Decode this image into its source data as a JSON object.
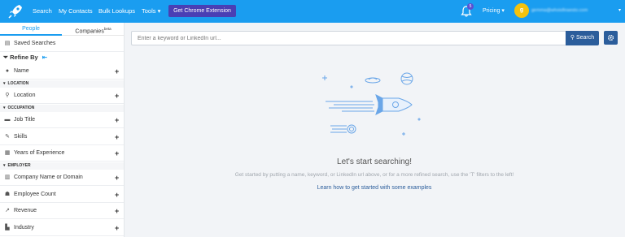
{
  "topbar": {
    "nav": {
      "search": "Search",
      "contacts": "My Contacts",
      "bulk": "Bulk Lookups",
      "tools": "Tools"
    },
    "tools_caret": "▾",
    "chrome_button": "Get Chrome Extension",
    "notification_count": "5",
    "pricing": "Pricing",
    "pricing_caret": "▾",
    "avatar_letter": "g",
    "user_email": "gemma@whoisfinaesto.com",
    "user_caret": "▾",
    "colors": {
      "bar": "#1a9df0",
      "chrome_button": "#4a3fb4",
      "avatar": "#f4c20d"
    }
  },
  "sidebar": {
    "tabs": {
      "people": "People",
      "companies": "Companies",
      "companies_badge": "beta"
    },
    "saved_searches": "Saved Searches",
    "refine_by": "Refine By",
    "refine_collapse_icon": "collapse-left-arrow",
    "filters": {
      "name": "Name",
      "location_section": "LOCATION",
      "location": "Location",
      "occupation_section": "OCCUPATION",
      "job_title": "Job Title",
      "skills": "Skills",
      "years_experience": "Years of Experience",
      "employer_section": "EMPLOYER",
      "company": "Company Name or Domain",
      "employee_count": "Employee Count",
      "revenue": "Revenue",
      "industry": "Industry"
    },
    "plus": "+",
    "section_caret": "▾"
  },
  "main": {
    "search_placeholder": "Enter a keyword or LinkedIn url...",
    "search_button": "Search",
    "empty_title": "Let's start searching!",
    "empty_subtitle": "Get started by putting a name, keyword, or LinkedIn url above, or for a more refined search, use the 'T' filters to the left!",
    "empty_link": "Learn how to get started with some examples",
    "colors": {
      "search_button": "#2b5d9b",
      "illustration": "#6aa6e8"
    }
  }
}
